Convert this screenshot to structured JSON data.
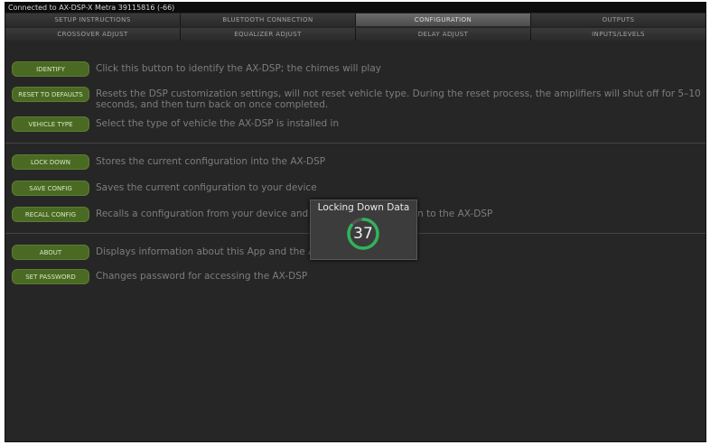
{
  "status_bar": "Connected to AX-DSP-X Metra 39115816 (-66)",
  "tabs_row1": [
    {
      "label": "SETUP INSTRUCTIONS",
      "active": false
    },
    {
      "label": "BLUETOOTH CONNECTION",
      "active": false
    },
    {
      "label": "CONFIGURATION",
      "active": true
    },
    {
      "label": "OUTPUTS",
      "active": false
    }
  ],
  "tabs_row2": [
    {
      "label": "CROSSOVER ADJUST",
      "active": false
    },
    {
      "label": "EQUALIZER ADJUST",
      "active": false
    },
    {
      "label": "DELAY ADJUST",
      "active": false
    },
    {
      "label": "INPUTS/LEVELS",
      "active": false
    }
  ],
  "rows": [
    {
      "button": "IDENTIFY",
      "desc": "Click this button to identify the AX-DSP; the chimes will play"
    },
    {
      "button": "RESET TO DEFAULTS",
      "desc": "Resets the DSP customization settings, will not reset vehicle type. During the reset process, the amplifiers will shut off for 5–10 seconds, and then turn back on once completed."
    },
    {
      "button": "VEHICLE TYPE",
      "desc": "Select the type of vehicle the AX-DSP is installed in"
    },
    {
      "button": "LOCK DOWN",
      "desc": "Stores the current configuration into the AX-DSP"
    },
    {
      "button": "SAVE CONFIG",
      "desc": "Saves the current configuration to your device"
    },
    {
      "button": "RECALL CONFIG",
      "desc": "Recalls a configuration from your device and sends the configuration to the AX-DSP"
    },
    {
      "button": "ABOUT",
      "desc": "Displays information about this App and the AX-DSP"
    },
    {
      "button": "SET PASSWORD",
      "desc": "Changes password for accessing the AX-DSP"
    }
  ],
  "dialog": {
    "title": "Locking Down Data",
    "progress_value": "37",
    "progress_fraction": 0.85
  },
  "colors": {
    "button_green": "#4a6a24",
    "progress_green": "#33b25a",
    "tab_active": "#5c5c5c"
  }
}
